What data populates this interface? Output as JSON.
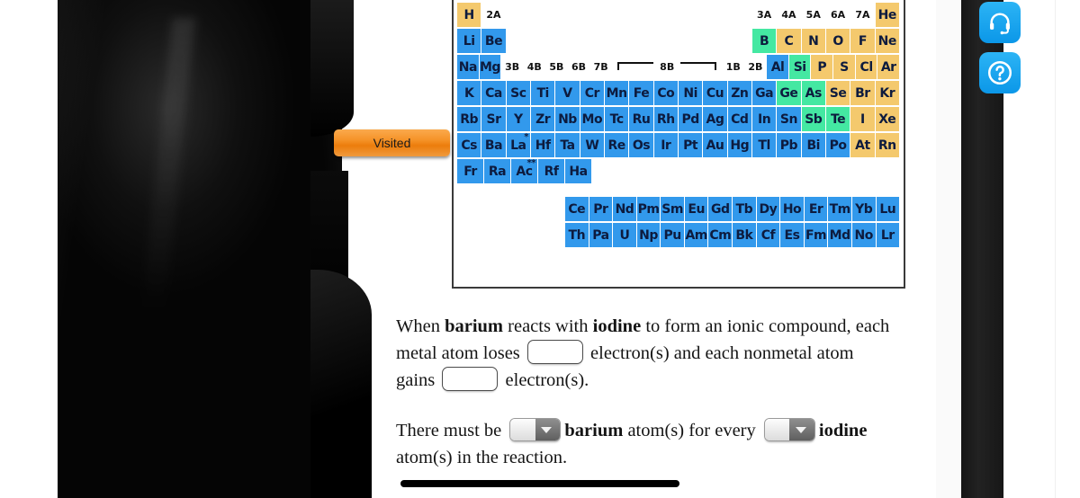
{
  "tab": {
    "label": "Visited"
  },
  "periodic_table": {
    "group_labels_left": [
      "2A"
    ],
    "group_labels_right": [
      "3A",
      "4A",
      "5A",
      "6A",
      "7A"
    ],
    "transition_labels": [
      "3B",
      "4B",
      "5B",
      "6B",
      "7B",
      "8B",
      "1B",
      "2B"
    ],
    "rows": [
      [
        {
          "sym": "H",
          "color": "orange"
        },
        {
          "sym": "2A",
          "color": "label"
        },
        {
          "sym": "",
          "color": "none"
        },
        {
          "sym": "",
          "color": "none"
        },
        {
          "sym": "",
          "color": "none"
        },
        {
          "sym": "",
          "color": "none"
        },
        {
          "sym": "",
          "color": "none"
        },
        {
          "sym": "",
          "color": "none"
        },
        {
          "sym": "",
          "color": "none"
        },
        {
          "sym": "",
          "color": "none"
        },
        {
          "sym": "",
          "color": "none"
        },
        {
          "sym": "",
          "color": "none"
        },
        {
          "sym": "3A",
          "color": "label"
        },
        {
          "sym": "4A",
          "color": "label"
        },
        {
          "sym": "5A",
          "color": "label"
        },
        {
          "sym": "6A",
          "color": "label"
        },
        {
          "sym": "7A",
          "color": "label"
        },
        {
          "sym": "He",
          "color": "orange"
        }
      ],
      [
        {
          "sym": "Li",
          "color": "blue"
        },
        {
          "sym": "Be",
          "color": "blue"
        },
        {
          "sym": "",
          "color": "none"
        },
        {
          "sym": "",
          "color": "none"
        },
        {
          "sym": "",
          "color": "none"
        },
        {
          "sym": "",
          "color": "none"
        },
        {
          "sym": "",
          "color": "none"
        },
        {
          "sym": "",
          "color": "none"
        },
        {
          "sym": "",
          "color": "none"
        },
        {
          "sym": "",
          "color": "none"
        },
        {
          "sym": "",
          "color": "none"
        },
        {
          "sym": "",
          "color": "none"
        },
        {
          "sym": "B",
          "color": "green"
        },
        {
          "sym": "C",
          "color": "orange"
        },
        {
          "sym": "N",
          "color": "orange"
        },
        {
          "sym": "O",
          "color": "orange"
        },
        {
          "sym": "F",
          "color": "orange"
        },
        {
          "sym": "Ne",
          "color": "orange"
        }
      ],
      [
        {
          "sym": "Na",
          "color": "blue"
        },
        {
          "sym": "Mg",
          "color": "blue"
        },
        {
          "sym": "3B",
          "color": "label"
        },
        {
          "sym": "4B",
          "color": "label"
        },
        {
          "sym": "5B",
          "color": "label"
        },
        {
          "sym": "6B",
          "color": "label"
        },
        {
          "sym": "7B",
          "color": "label"
        },
        {
          "sym": "8B",
          "color": "label8b"
        },
        {
          "sym": "1B",
          "color": "label"
        },
        {
          "sym": "2B",
          "color": "label"
        },
        {
          "sym": "Al",
          "color": "blue"
        },
        {
          "sym": "Si",
          "color": "green"
        },
        {
          "sym": "P",
          "color": "orange"
        },
        {
          "sym": "S",
          "color": "orange"
        },
        {
          "sym": "Cl",
          "color": "orange"
        },
        {
          "sym": "Ar",
          "color": "orange"
        }
      ],
      [
        {
          "sym": "K",
          "color": "blue"
        },
        {
          "sym": "Ca",
          "color": "blue"
        },
        {
          "sym": "Sc",
          "color": "blue"
        },
        {
          "sym": "Ti",
          "color": "blue"
        },
        {
          "sym": "V",
          "color": "blue"
        },
        {
          "sym": "Cr",
          "color": "blue"
        },
        {
          "sym": "Mn",
          "color": "blue"
        },
        {
          "sym": "Fe",
          "color": "blue"
        },
        {
          "sym": "Co",
          "color": "blue"
        },
        {
          "sym": "Ni",
          "color": "blue"
        },
        {
          "sym": "Cu",
          "color": "blue"
        },
        {
          "sym": "Zn",
          "color": "blue"
        },
        {
          "sym": "Ga",
          "color": "blue"
        },
        {
          "sym": "Ge",
          "color": "green"
        },
        {
          "sym": "As",
          "color": "green"
        },
        {
          "sym": "Se",
          "color": "orange"
        },
        {
          "sym": "Br",
          "color": "orange"
        },
        {
          "sym": "Kr",
          "color": "orange"
        }
      ],
      [
        {
          "sym": "Rb",
          "color": "blue"
        },
        {
          "sym": "Sr",
          "color": "blue"
        },
        {
          "sym": "Y",
          "color": "blue"
        },
        {
          "sym": "Zr",
          "color": "blue"
        },
        {
          "sym": "Nb",
          "color": "blue"
        },
        {
          "sym": "Mo",
          "color": "blue"
        },
        {
          "sym": "Tc",
          "color": "blue"
        },
        {
          "sym": "Ru",
          "color": "blue"
        },
        {
          "sym": "Rh",
          "color": "blue"
        },
        {
          "sym": "Pd",
          "color": "blue"
        },
        {
          "sym": "Ag",
          "color": "blue"
        },
        {
          "sym": "Cd",
          "color": "blue"
        },
        {
          "sym": "In",
          "color": "blue"
        },
        {
          "sym": "Sn",
          "color": "blue"
        },
        {
          "sym": "Sb",
          "color": "green"
        },
        {
          "sym": "Te",
          "color": "green"
        },
        {
          "sym": "I",
          "color": "orange"
        },
        {
          "sym": "Xe",
          "color": "orange"
        }
      ],
      [
        {
          "sym": "Cs",
          "color": "blue"
        },
        {
          "sym": "Ba",
          "color": "blue"
        },
        {
          "sym": "La",
          "color": "blue",
          "mark": "*"
        },
        {
          "sym": "Hf",
          "color": "blue"
        },
        {
          "sym": "Ta",
          "color": "blue"
        },
        {
          "sym": "W",
          "color": "blue"
        },
        {
          "sym": "Re",
          "color": "blue"
        },
        {
          "sym": "Os",
          "color": "blue"
        },
        {
          "sym": "Ir",
          "color": "blue"
        },
        {
          "sym": "Pt",
          "color": "blue"
        },
        {
          "sym": "Au",
          "color": "blue"
        },
        {
          "sym": "Hg",
          "color": "blue"
        },
        {
          "sym": "Tl",
          "color": "blue"
        },
        {
          "sym": "Pb",
          "color": "blue"
        },
        {
          "sym": "Bi",
          "color": "blue"
        },
        {
          "sym": "Po",
          "color": "blue"
        },
        {
          "sym": "At",
          "color": "orange"
        },
        {
          "sym": "Rn",
          "color": "orange"
        }
      ],
      [
        {
          "sym": "Fr",
          "color": "blue"
        },
        {
          "sym": "Ra",
          "color": "blue"
        },
        {
          "sym": "Ac",
          "color": "blue",
          "mark": "**"
        },
        {
          "sym": "Rf",
          "color": "blue"
        },
        {
          "sym": "Ha",
          "color": "blue"
        }
      ]
    ],
    "lanthanides": [
      "Ce",
      "Pr",
      "Nd",
      "Pm",
      "Sm",
      "Eu",
      "Gd",
      "Tb",
      "Dy",
      "Ho",
      "Er",
      "Tm",
      "Yb",
      "Lu"
    ],
    "actinides": [
      "Th",
      "Pa",
      "U",
      "Np",
      "Pu",
      "Am",
      "Cm",
      "Bk",
      "Cf",
      "Es",
      "Fm",
      "Md",
      "No",
      "Lr"
    ],
    "colors": {
      "metal": "#3299ec",
      "nonmetal": "#f4c96d",
      "metalloid": "#44e8a2",
      "border": "#3a3a3a"
    }
  },
  "question": {
    "part1": {
      "text_a": "When ",
      "bold_a": "barium",
      "text_b": " reacts with ",
      "bold_b": "iodine",
      "text_c": " to form an ionic compound, each metal atom loses ",
      "input1_value": "",
      "text_d": " electron(s) and each nonmetal atom gains ",
      "input2_value": "",
      "text_e": " electron(s)."
    },
    "part2": {
      "text_a": "There must be ",
      "select1_value": "",
      "bold_a": "barium",
      "text_b": " atom(s) for every ",
      "select2_value": "",
      "bold_b": "iodine",
      "text_c": " atom(s) in the reaction."
    }
  },
  "sidebar": {
    "buttons": [
      {
        "name": "headset-icon",
        "tooltip": "Support"
      },
      {
        "name": "question-mark-icon",
        "tooltip": "Help"
      }
    ],
    "accent_color": "#0b97e8"
  }
}
